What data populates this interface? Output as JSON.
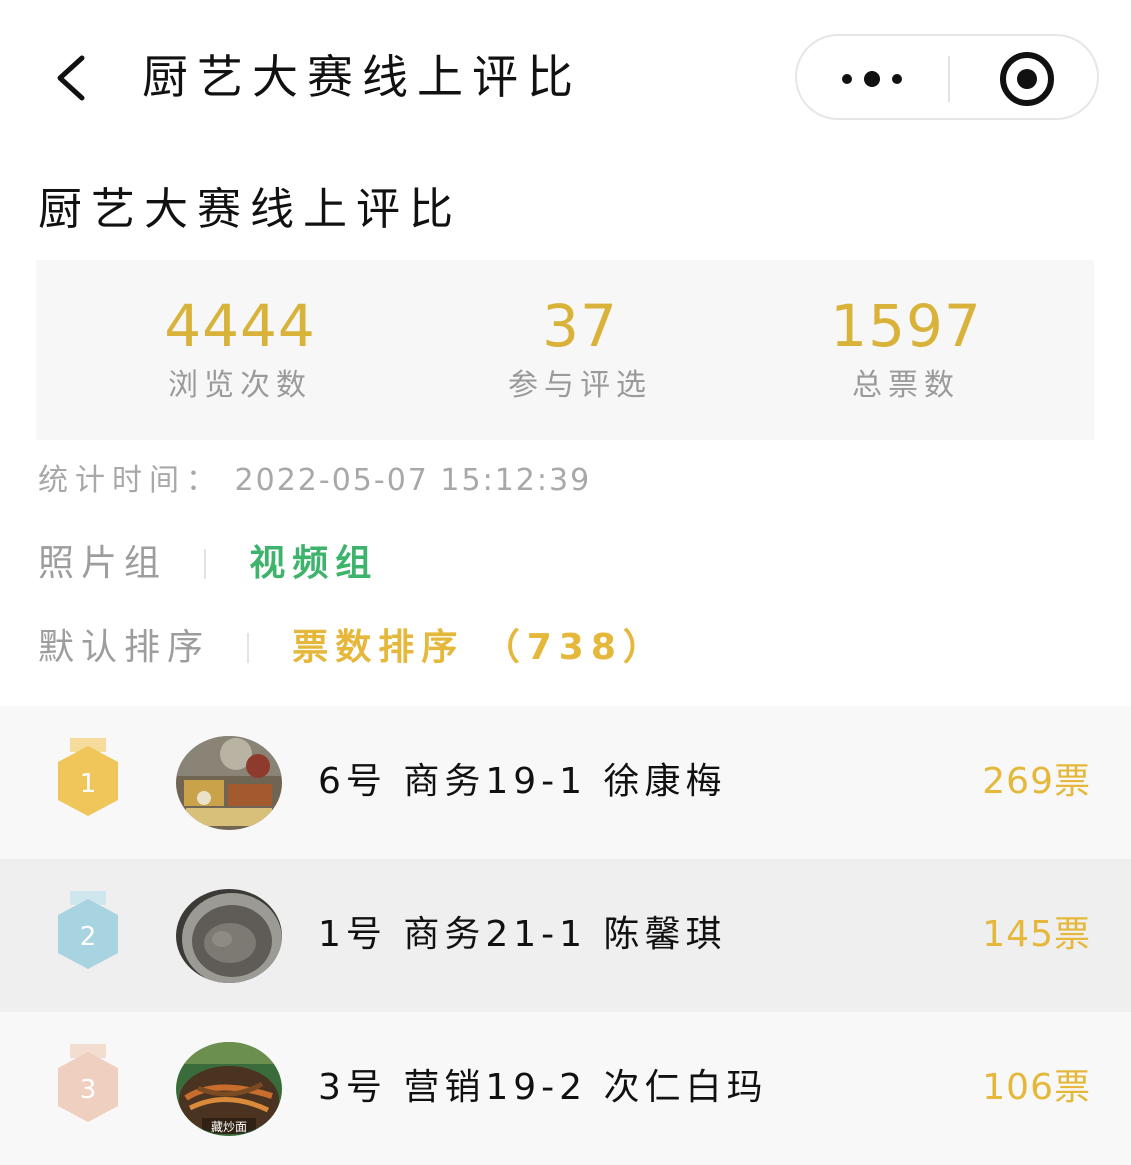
{
  "navbar": {
    "title": "厨艺大赛线上评比"
  },
  "page": {
    "title": "厨艺大赛线上评比"
  },
  "stats": [
    {
      "value": "4444",
      "label": "浏览次数"
    },
    {
      "value": "37",
      "label": "参与评选"
    },
    {
      "value": "1597",
      "label": "总票数"
    }
  ],
  "stat_time": {
    "label": "统计时间：",
    "value": "2022-05-07 15:12:39"
  },
  "group_tabs": {
    "photo": "照片组",
    "video": "视频组",
    "active": "video"
  },
  "sort_tabs": {
    "default": "默认排序",
    "votes": "票数排序 （738）",
    "active": "votes"
  },
  "colors": {
    "accent_gold": "#e5b83b",
    "accent_green": "#3db36b",
    "medal_gold": "#f0c65b",
    "medal_silver": "#a8d3e0",
    "medal_bronze": "#efcfbf"
  },
  "ranking": [
    {
      "rank": "1",
      "medal": "gold-medal-icon",
      "name": "6号 商务19-1 徐康梅",
      "votes": "269票"
    },
    {
      "rank": "2",
      "medal": "silver-medal-icon",
      "name": "1号 商务21-1 陈馨琪",
      "votes": "145票"
    },
    {
      "rank": "3",
      "medal": "bronze-medal-icon",
      "name": "3号 营销19-2 次仁白玛",
      "votes": "106票",
      "thumb_caption": "藏炒面"
    }
  ]
}
